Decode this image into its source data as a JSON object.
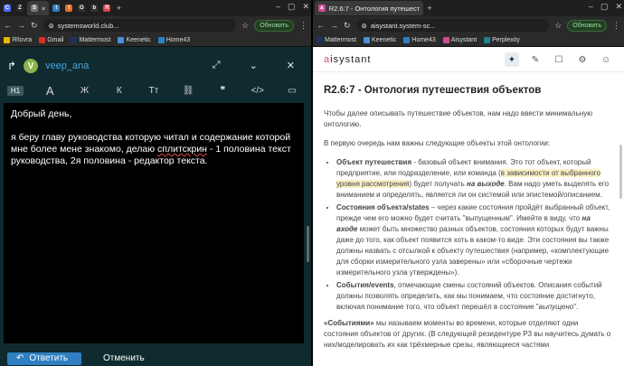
{
  "left_window": {
    "tabs": [
      {
        "icon_color": "#4c6ef5",
        "glyph": "C"
      },
      {
        "icon_color": "#2b2b2b",
        "glyph": "Z"
      },
      {
        "icon_color": "#777777",
        "glyph": "S"
      },
      {
        "icon_color": "#2f7fc2",
        "glyph": "t"
      },
      {
        "icon_color": "#e06f2b",
        "glyph": "t"
      },
      {
        "icon_color": "#333333",
        "glyph": "O"
      },
      {
        "icon_color": "#333333",
        "glyph": "b"
      },
      {
        "icon_color": "#d44",
        "glyph": "R"
      },
      {
        "icon_color": "#d44",
        "glyph": "×"
      }
    ],
    "url": "systemsworld.club...",
    "refresh_label": "Обновить",
    "bookmarks": [
      {
        "label": "Я!lovra",
        "color": "#e6b800"
      },
      {
        "label": "Gmail",
        "color": "#d93025"
      },
      {
        "label": "Mattermost",
        "color": "#1e325c"
      },
      {
        "label": "Keenetic",
        "color": "#4c8ed9"
      },
      {
        "label": "Home43",
        "color": "#2f7fc2"
      }
    ],
    "reply": {
      "avatar_letter": "V",
      "username": "veep_ana",
      "toolbar": [
        "H1",
        "A",
        "Ж",
        "К",
        "Tт",
        "link",
        "99",
        "</>",
        "img"
      ],
      "body": [
        "Добрый день,",
        "я беру главу руководства которую читал и содержание которой мне более мене знакомо, делаю сплитскрин - 1 половина текст руководства, 2я половина - редактор текста."
      ],
      "misspelled_word": "сплитскрин",
      "reply_button": "Ответить",
      "cancel_button": "Отменить"
    }
  },
  "right_window": {
    "tab_title": "R2.6:7 - Онтология путешеств",
    "url": "aisystant.system-sc...",
    "refresh_label": "Обновить",
    "bookmarks": [
      {
        "label": "Mattermost",
        "color": "#1e325c"
      },
      {
        "label": "Keenetic",
        "color": "#4c8ed9"
      },
      {
        "label": "Home43",
        "color": "#2f7fc2"
      },
      {
        "label": "Aisystant",
        "color": "#d14b8f"
      },
      {
        "label": "Perplexity",
        "color": "#20808d"
      }
    ],
    "logo_prefix": "a",
    "logo_rest": "isystant",
    "title": "R2.6:7 - Онтология путешествия объектов",
    "intro": "Чтобы далее описывать путешествие объектов, нам надо ввести минимальную онтологию.",
    "lead": "В первую очередь нам важны следующие объекты этой онтологии:",
    "items": [
      {
        "term": "Объект путешествия",
        "before": " - базовый объект внимания. Это тот объект, который предприятие, или подразделение, или команда (",
        "highlight": "в зависимости от выбранного уровня рассмотрения",
        "after": ") будет получать ",
        "em": "на выходе",
        "tail": ". Вам надо уметь выделять его вниманием и определять, является ли он системой или эпистемой/описанием."
      },
      {
        "term": "Состояния объекта/states",
        "before": " – через какие состояния пройдёт выбранный объект, прежде чем его можно будет считать \"выпущенным\". Имейте в виду, что ",
        "em": "на входе",
        "tail": " может быть множество разных объектов, состояния которых будут важны даже до того, как объект появится хоть в каком-то виде. Эти состояния вы также должны назвать с отсылкой к объекту путешествия (например, «комплектующие для сборки измерительного узла заверены» или «сборочные чертежи измерительного узла утверждены»)."
      },
      {
        "term": "События/events",
        "before": ", отмечающие смены состояний объектов. Описания событий должны позволять определить, как мы понимаем, что состояние достигнуто, включая понимание того, что объект перешёл в состояние \"",
        "em": "выпущено",
        "tail": "\"."
      }
    ],
    "outro_em": "«Событиями»",
    "outro": " мы называем моменты во времени, которые отделяют одни состояния объектов от других. (В следующей резидентуре Р3 вы научитесь думать о них/моделировать их как трёхмерные срезы, являющиеся частями"
  }
}
